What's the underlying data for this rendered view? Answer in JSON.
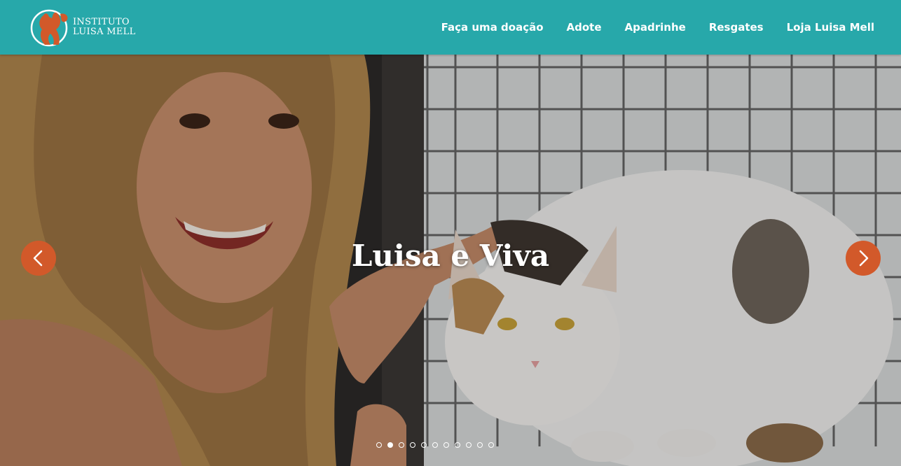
{
  "logo": {
    "line1": "INSTITUTO",
    "line2": "LUISA MELL",
    "icon": "dog-cat-logo-icon"
  },
  "nav": {
    "items": [
      {
        "label": "Faça uma doação"
      },
      {
        "label": "Adote"
      },
      {
        "label": "Apadrinhe"
      },
      {
        "label": "Resgates"
      },
      {
        "label": "Loja Luisa Mell"
      }
    ]
  },
  "slider": {
    "caption": "Luisa e Viva",
    "prev_icon": "chevron-left-icon",
    "next_icon": "chevron-right-icon",
    "slide_count": 11,
    "active_slide": 2
  },
  "colors": {
    "header_bg": "#27a8aa",
    "accent": "#d2592a",
    "text": "#ffffff"
  }
}
